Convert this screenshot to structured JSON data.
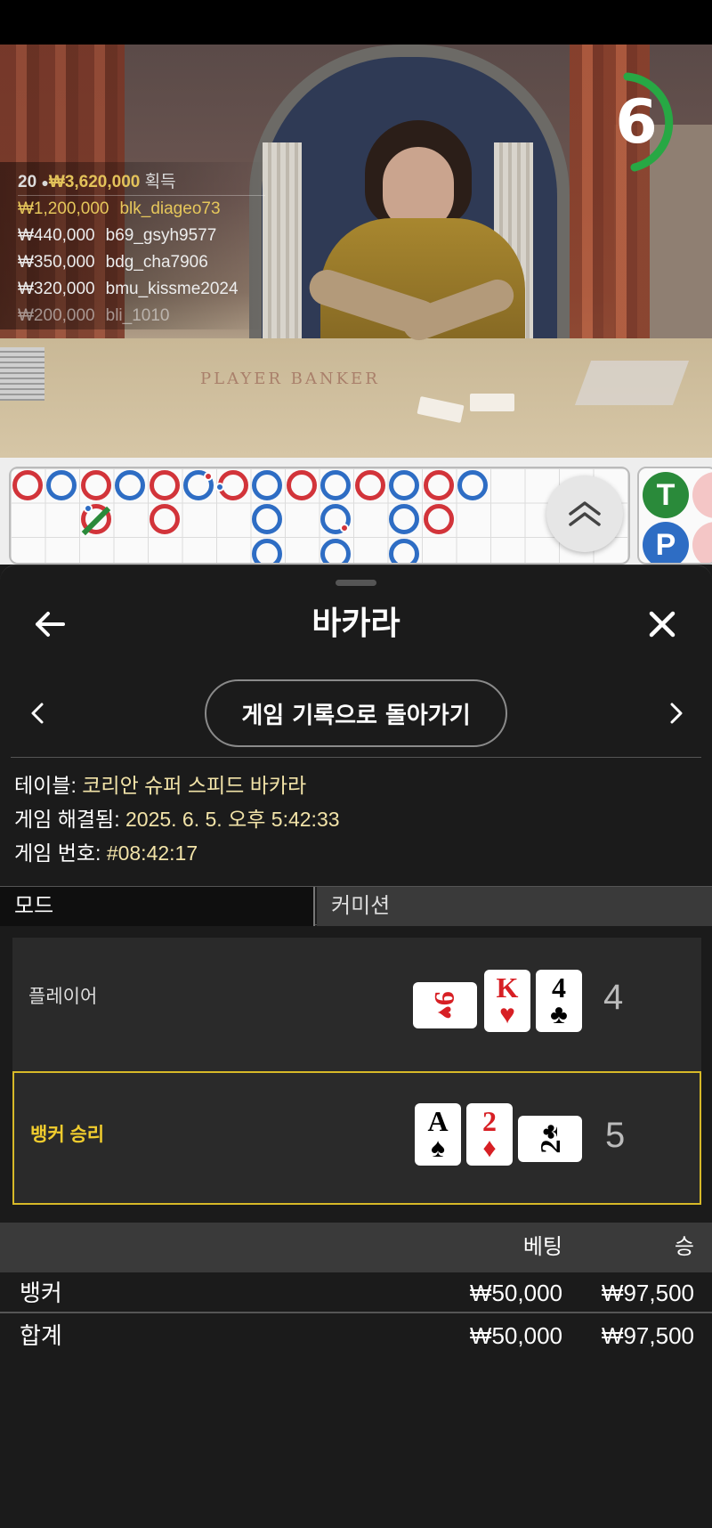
{
  "video": {
    "timer": "6",
    "table_text": "PLAYER    BANKER",
    "winners": {
      "count": "20",
      "total": "₩3,620,000",
      "label": "획득",
      "rows": [
        {
          "amount": "₩1,200,000",
          "user": "blk_diageo73"
        },
        {
          "amount": "₩440,000",
          "user": "b69_gsyh9577"
        },
        {
          "amount": "₩350,000",
          "user": "bdg_cha7906"
        },
        {
          "amount": "₩320,000",
          "user": "bmu_kissme2024"
        },
        {
          "amount": "₩200,000",
          "user": "bli_1010"
        }
      ]
    },
    "colors": {
      "gold": "#e3c25a",
      "timer_ring": "#27a844"
    }
  },
  "roadmap": {
    "side": {
      "tie": "T",
      "player": "P"
    },
    "colors": {
      "banker": "#d2343a",
      "player": "#2e6dc4",
      "tie": "#2a8a3a"
    }
  },
  "sheet": {
    "title": "바카라",
    "history_button": "게임 기록으로 돌아가기",
    "info": {
      "table_label": "테이블: ",
      "table_value": "코리안 슈퍼 스피드 바카라",
      "resolved_label": "게임 해결됨: ",
      "resolved_value": "2025. 6. 5. 오후 5:42:33",
      "number_label": "게임 번호: ",
      "number_value": "#08:42:17"
    },
    "tabs": {
      "mode": "모드",
      "commission": "커미션"
    },
    "player": {
      "label": "플레이어",
      "score": "4",
      "cards": [
        {
          "rank": "9",
          "suit": "♥",
          "color": "red",
          "rotated": true
        },
        {
          "rank": "K",
          "suit": "♥",
          "color": "red",
          "rotated": false
        },
        {
          "rank": "4",
          "suit": "♣",
          "color": "black",
          "rotated": false
        }
      ]
    },
    "banker": {
      "label": "뱅커 승리",
      "score": "5",
      "cards": [
        {
          "rank": "A",
          "suit": "♠",
          "color": "black",
          "rotated": false
        },
        {
          "rank": "2",
          "suit": "♦",
          "color": "red",
          "rotated": false
        },
        {
          "rank": "2",
          "suit": "♣",
          "color": "black",
          "rotated": true
        }
      ]
    },
    "bets": {
      "header_bet": "베팅",
      "header_win": "승",
      "rows": [
        {
          "name": "뱅커",
          "bet": "₩50,000",
          "win": "₩97,500"
        },
        {
          "name": "합계",
          "bet": "₩50,000",
          "win": "₩97,500"
        }
      ]
    },
    "colors": {
      "highlight": "#d7b928",
      "value_text": "#f2e3a8"
    }
  }
}
